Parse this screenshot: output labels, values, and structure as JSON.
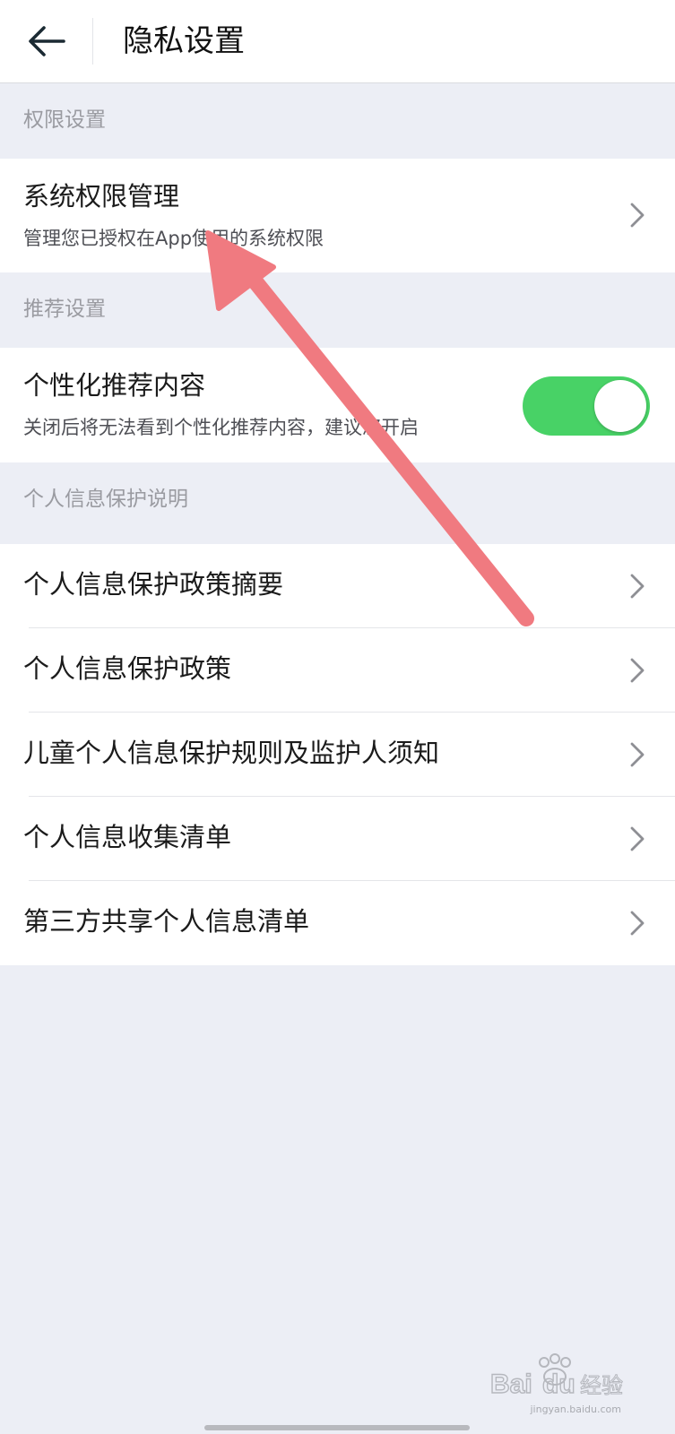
{
  "header": {
    "title": "隐私设置",
    "back_icon": "arrow-left-icon"
  },
  "sections": {
    "permissions": {
      "label": "权限设置"
    },
    "recommend": {
      "label": "推荐设置"
    },
    "protection": {
      "label": "个人信息保护说明"
    }
  },
  "rows": {
    "system_permissions": {
      "title": "系统权限管理",
      "subtitle": "管理您已授权在App使用的系统权限"
    },
    "personalized": {
      "title": "个性化推荐内容",
      "subtitle": "关闭后将无法看到个性化推荐内容，建议您开启",
      "toggle_on": true,
      "toggle_color": "#48d266"
    },
    "policy_summary": {
      "title": "个人信息保护政策摘要"
    },
    "policy": {
      "title": "个人信息保护政策"
    },
    "children_rules": {
      "title": "儿童个人信息保护规则及监护人须知"
    },
    "collection_list": {
      "title": "个人信息收集清单"
    },
    "third_party_list": {
      "title": "第三方共享个人信息清单"
    }
  },
  "annotation": {
    "color": "#f07a80"
  },
  "watermark": {
    "logo": "Baidu经验",
    "sub": "jingyan.baidu.com"
  }
}
